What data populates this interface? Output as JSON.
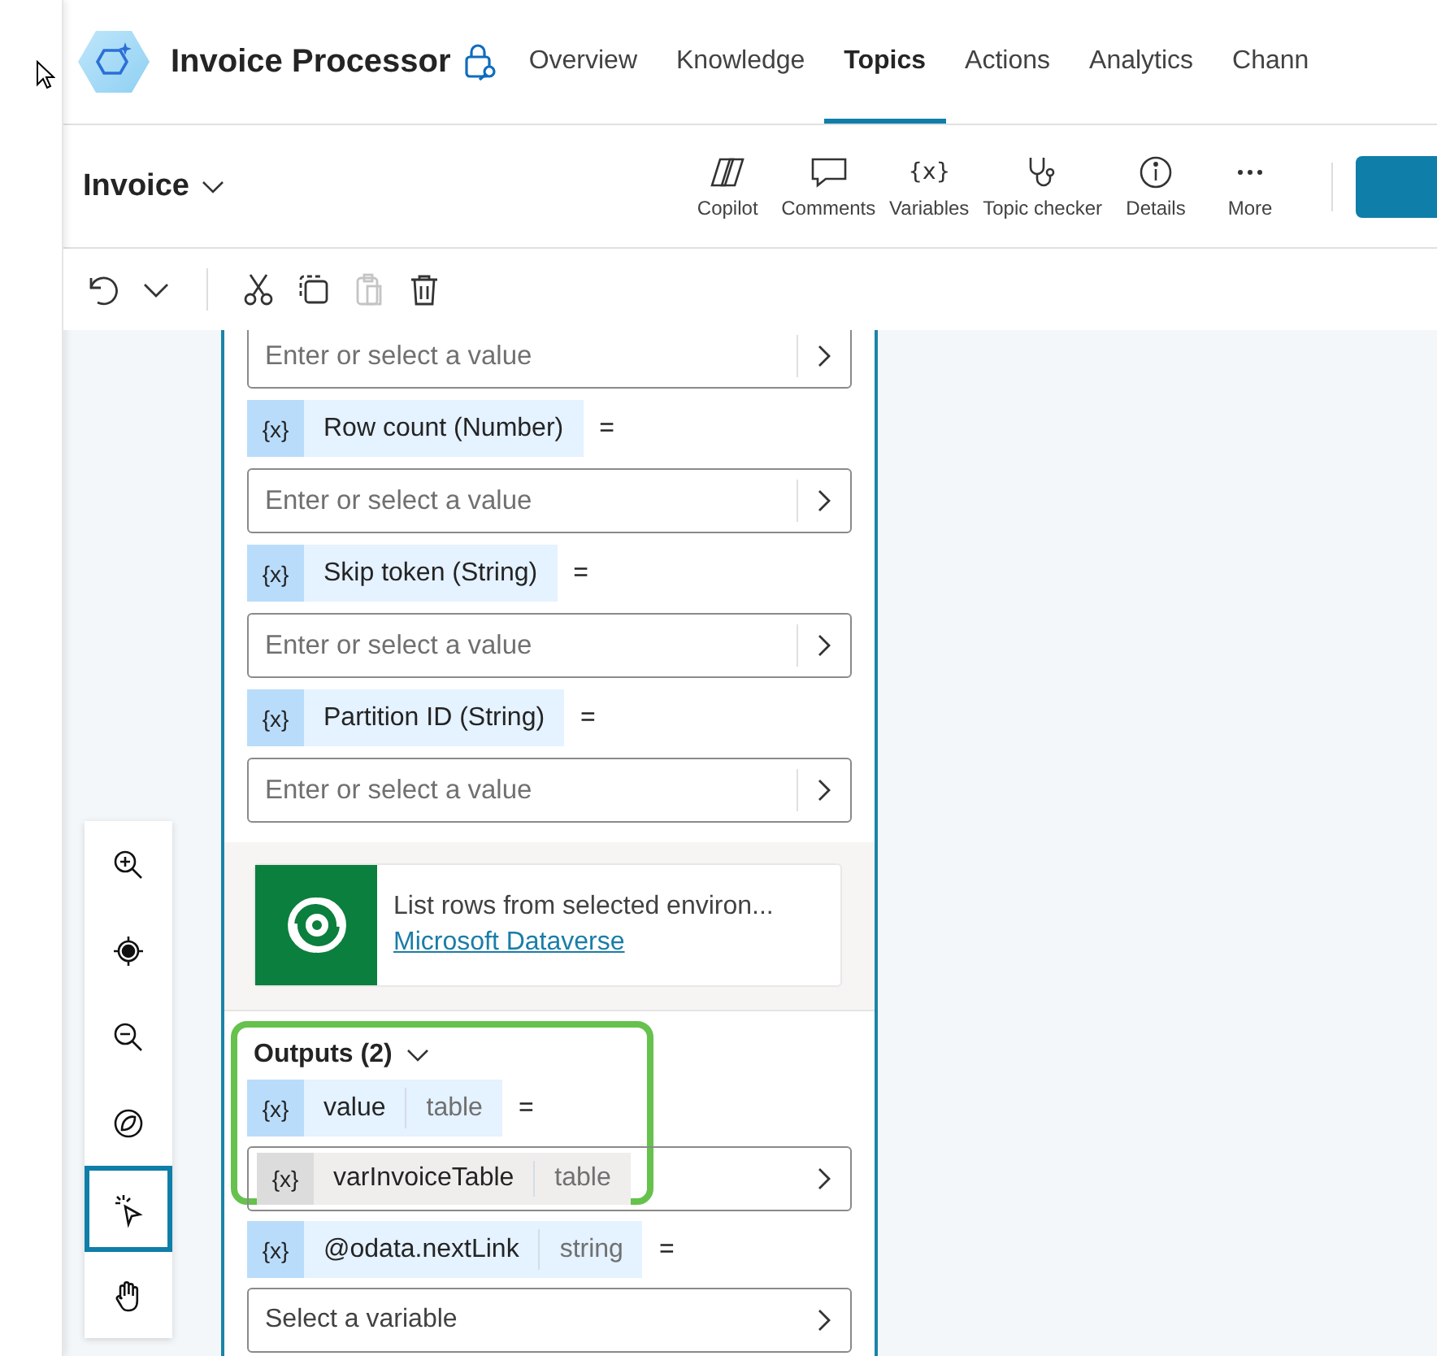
{
  "header": {
    "title": "Invoice Processor",
    "tabs": [
      {
        "label": "Overview",
        "selected": false
      },
      {
        "label": "Knowledge",
        "selected": false
      },
      {
        "label": "Topics",
        "selected": true
      },
      {
        "label": "Actions",
        "selected": false
      },
      {
        "label": "Analytics",
        "selected": false
      },
      {
        "label": "Chann",
        "selected": false
      }
    ]
  },
  "topic_bar": {
    "topic": "Invoice",
    "tools": [
      {
        "kind": "copilot",
        "label": "Copilot"
      },
      {
        "kind": "comments",
        "label": "Comments"
      },
      {
        "kind": "variables",
        "label": "Variables",
        "icon_text": "{x}"
      },
      {
        "kind": "checker",
        "label": "Topic checker"
      },
      {
        "kind": "details",
        "label": "Details"
      },
      {
        "kind": "more",
        "label": "More"
      }
    ]
  },
  "edit_tools": [
    {
      "kind": "undo",
      "disabled": false
    },
    {
      "kind": "caret",
      "disabled": false
    },
    {
      "kind": "cut",
      "disabled": false
    },
    {
      "kind": "copy",
      "disabled": false
    },
    {
      "kind": "paste",
      "disabled": true
    },
    {
      "kind": "delete",
      "disabled": false
    }
  ],
  "canvas_tools": [
    {
      "kind": "zoom-in",
      "selected": false
    },
    {
      "kind": "center",
      "selected": false
    },
    {
      "kind": "zoom-out",
      "selected": false
    },
    {
      "kind": "minimap",
      "selected": false
    },
    {
      "kind": "select",
      "selected": true
    },
    {
      "kind": "pan",
      "selected": false
    }
  ],
  "inputs": [
    {
      "placeholder": "Enter or select a value"
    },
    {
      "badge": "{x}",
      "name": "Row count (Number)",
      "equals": "=",
      "placeholder": "Enter or select a value"
    },
    {
      "badge": "{x}",
      "name": "Skip token (String)",
      "equals": "=",
      "placeholder": "Enter or select a value"
    },
    {
      "badge": "{x}",
      "name": "Partition ID (String)",
      "equals": "=",
      "placeholder": "Enter or select a value"
    }
  ],
  "connector": {
    "description": "List rows from selected environ...",
    "link": "Microsoft Dataverse"
  },
  "outputs": {
    "title": "Outputs (2)",
    "highlighted": true,
    "items": [
      {
        "badge": "{x}",
        "name": "value",
        "type": "table",
        "equals": "=",
        "value_badge": "{x}",
        "value_name": "varInvoiceTable",
        "value_type": "table"
      },
      {
        "badge": "{x}",
        "name": "@odata.nextLink",
        "type": "string",
        "equals": "=",
        "placeholder": "Select a variable"
      }
    ]
  }
}
